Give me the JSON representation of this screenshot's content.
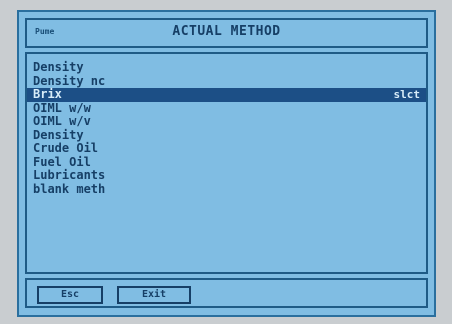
{
  "header": {
    "prev": "Pume",
    "title": "ACTUAL METHOD"
  },
  "list": {
    "items": [
      {
        "label": "Density",
        "tag": ""
      },
      {
        "label": "Density nc",
        "tag": ""
      },
      {
        "label": "Brix",
        "tag": "slct",
        "selected": true
      },
      {
        "label": "OIML w/w",
        "tag": ""
      },
      {
        "label": "OIML w/v",
        "tag": ""
      },
      {
        "label": "Density",
        "tag": ""
      },
      {
        "label": "Crude Oil",
        "tag": ""
      },
      {
        "label": "Fuel Oil",
        "tag": ""
      },
      {
        "label": "Lubricants",
        "tag": ""
      },
      {
        "label": "blank meth",
        "tag": ""
      }
    ]
  },
  "footer": {
    "esc_label": "Esc",
    "exit_label": "Exit"
  },
  "colors": {
    "screen_bg": "#80bde3",
    "text": "#163f66",
    "selection_bg": "#1c4f86",
    "selection_text": "#d7ecf8"
  }
}
